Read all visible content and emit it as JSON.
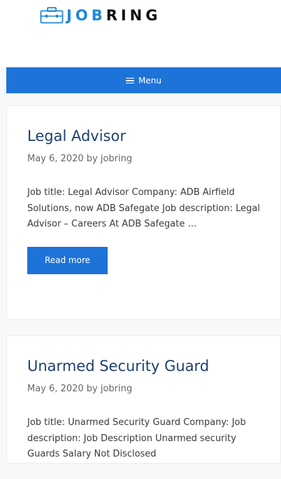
{
  "header": {
    "logo_parts": [
      {
        "text": "J",
        "color": "#1e88d6"
      },
      {
        "text": "O",
        "color": "#1e88d6"
      },
      {
        "text": "B",
        "color": "#1e88d6"
      },
      {
        "text": "RING",
        "color": "#111111"
      }
    ],
    "logo_icon": "briefcase-icon"
  },
  "nav": {
    "menu_label": "Menu",
    "menu_icon": "hamburger-icon",
    "bar_color": "#1e73d8"
  },
  "posts": [
    {
      "title": "Legal Advisor",
      "meta": "May 6, 2020 by jobring",
      "excerpt": "Job title: Legal Advisor Company: ADB Airfield Solutions, now ADB Safegate Job description: Legal Advisor – Careers At ADB Safegate …",
      "read_more": "Read more"
    },
    {
      "title": "Unarmed Security Guard",
      "meta": "May 6, 2020 by jobring",
      "excerpt": "Job title: Unarmed Security Guard Company: Job description: Job Description Unarmed security Guards Salary Not Disclosed"
    }
  ],
  "colors": {
    "title": "#1f3f6e",
    "accent": "#1e73d8"
  }
}
